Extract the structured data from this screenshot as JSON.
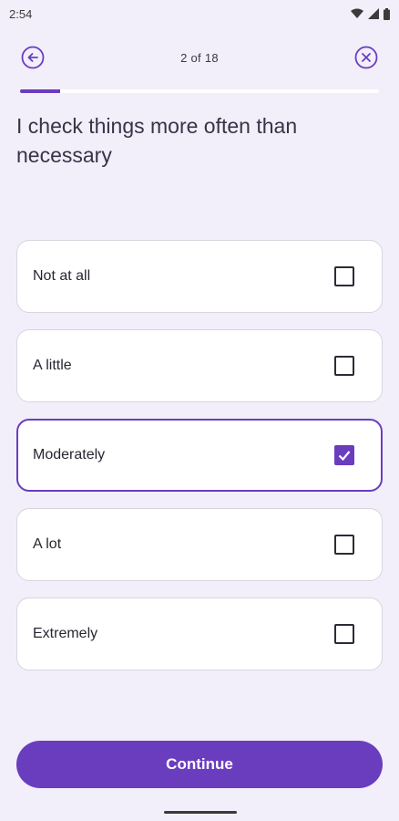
{
  "status_bar": {
    "time": "2:54",
    "icons": [
      "wifi-icon",
      "signal-icon",
      "battery-icon"
    ]
  },
  "header": {
    "back_icon": "arrow-left-circle-icon",
    "step_counter": "2 of 18",
    "close_icon": "close-circle-icon"
  },
  "progress": {
    "current_step": 2,
    "total_steps": 18,
    "fraction": 0.111
  },
  "question": "I check things more often than necessary",
  "options": [
    {
      "label": "Not at all",
      "checked": false
    },
    {
      "label": "A little",
      "checked": false
    },
    {
      "label": "Moderately",
      "checked": true
    },
    {
      "label": "A lot",
      "checked": false
    },
    {
      "label": "Extremely",
      "checked": false
    }
  ],
  "continue_label": "Continue",
  "colors": {
    "accent": "#6a3dbf",
    "background": "#f2eefa",
    "card": "#ffffff"
  }
}
